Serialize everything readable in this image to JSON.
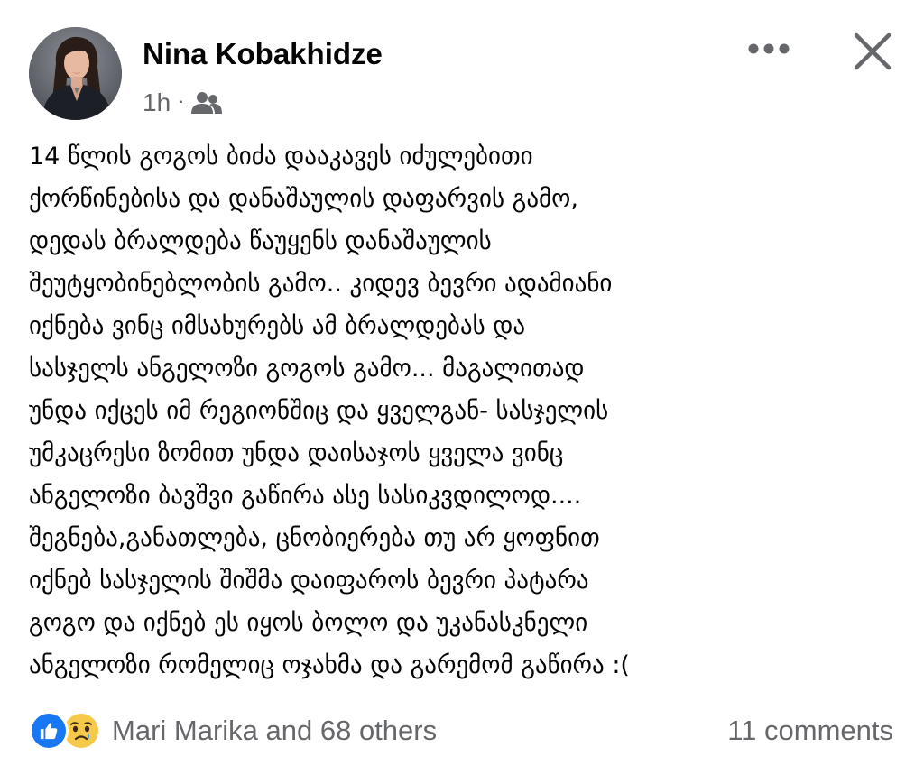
{
  "post": {
    "author_name": "Nina Kobakhidze",
    "time": "1h",
    "separator": "·",
    "audience_icon": "friends-icon",
    "actions": {
      "more_icon": "more-horizontal-icon",
      "close_icon": "close-icon"
    },
    "body_lines": [
      "14 წლის გოგოს ბიძა დააკავეს იძულებითი",
      "ქორწინებისა და დანაშაულის დაფარვის გამო,",
      "დედას ბრალდება წაუყენს დანაშაულის",
      "შეუტყობინებლობის გამო.. კიდევ ბევრი ადამიანი",
      "იქნება ვინც იმსახურებს ამ ბრალდებას და",
      "სასჯელს  ანგელოზი გოგოს გამო... მაგალითად",
      "უნდა იქცეს იმ რეგიონშიც და ყველგან- სასჯელის",
      "უმკაცრესი ზომით უნდა დაისაჯოს ყველა ვინც",
      "ანგელოზი ბავშვი გაწირა ასე სასიკვდილოდ....",
      "შეგნება,განათლება, ცნობიერება თუ არ ყოფნით",
      "იქნებ სასჯელის შიშმა დაიფაროს ბევრი პატარა",
      "გოგო  და იქნებ ეს იყოს ბოლო და უკანასკნელი",
      "ანგელოზი რომელიც ოჯახმა და გარემომ გაწირა :("
    ],
    "footer": {
      "reaction_icons": [
        "like-icon",
        "sad-icon"
      ],
      "reactors_text": "Mari Marika and 68 others",
      "comments_text": "11 comments"
    },
    "colors": {
      "text": "#050505",
      "secondary_text": "#65676b",
      "like_blue": "#1877f2",
      "sad_yellow": "#f7c94b"
    }
  }
}
